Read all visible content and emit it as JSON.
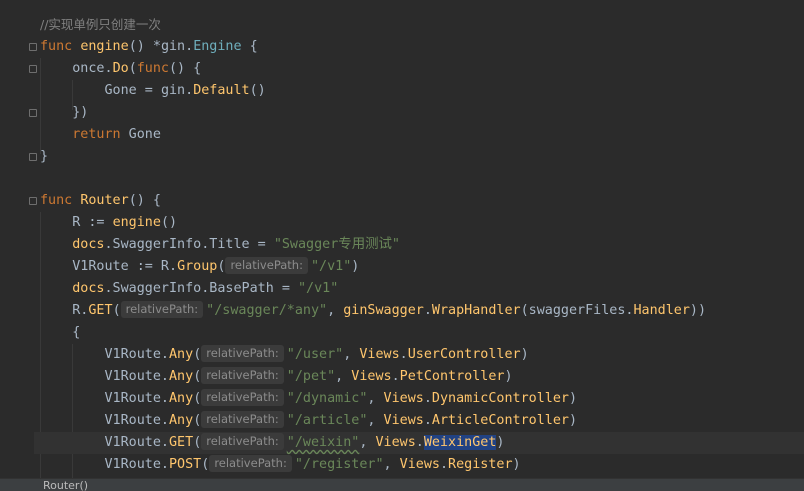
{
  "editor": {
    "comment": "//实现单例只创建一次",
    "engine_func": {
      "kw_func": "func",
      "name": "engine",
      "sig": "() *",
      "pkg": "gin",
      "dot": ".",
      "type": "Engine",
      "open": " {"
    },
    "once_line": {
      "obj": "once.",
      "method": "Do",
      "paren": "(",
      "kw": "func",
      "rest": "() {"
    },
    "gone_line": {
      "lhs": "Gone = ",
      "pkg": "gin",
      "dot": ".",
      "method": "Default",
      "rest": "()"
    },
    "close_paren": "})",
    "return_line": {
      "kw": "return",
      "rest": " Gone"
    },
    "close_brace": "}",
    "router_func": {
      "kw_func": "func",
      "name": "Router",
      "rest": "() {"
    },
    "r_line": {
      "lhs": "R := ",
      "call": "engine",
      "rest": "()"
    },
    "title_line": {
      "pkg": "docs",
      "rest": ".SwaggerInfo.Title = ",
      "str": "\"Swagger专用测试\""
    },
    "v1route_line": {
      "lhs": "V1Route := R.",
      "method": "Group",
      "paren": "(",
      "hint": "relativePath:",
      "str": "\"/v1\"",
      "rest": ")"
    },
    "basepath_line": {
      "pkg": "docs",
      "rest": ".SwaggerInfo.BasePath = ",
      "str": "\"/v1\""
    },
    "rget_line": {
      "obj": "R.",
      "method": "GET",
      "paren": "(",
      "hint": "relativePath:",
      "str": "\"/swagger/*any\"",
      "comma": ", ",
      "pkg": "ginSwagger",
      "dot": ".",
      "call": "WrapHandler",
      "arg": "(swaggerFiles.",
      "arg_field": "Handler",
      "end": "))"
    },
    "open_block": "{",
    "routes": [
      {
        "method": "Any",
        "hint": "relativePath:",
        "path": "\"/user\"",
        "handler": "UserController"
      },
      {
        "method": "Any",
        "hint": "relativePath:",
        "path": "\"/pet\"",
        "handler": "PetController"
      },
      {
        "method": "Any",
        "hint": "relativePath:",
        "path": "\"/dynamic\"",
        "handler": "DynamicController"
      },
      {
        "method": "Any",
        "hint": "relativePath:",
        "path": "\"/article\"",
        "handler": "ArticleController"
      },
      {
        "method": "GET",
        "hint": "relativePath:",
        "path": "\"/weixin\"",
        "handler": "WeixinGet"
      },
      {
        "method": "POST",
        "hint": "relativePath:",
        "path": "\"/register\"",
        "handler": "Register"
      }
    ],
    "route_obj": "V1Route.",
    "views_pkg": "Views",
    "dot": ".",
    "comma": ", ",
    "close": ")"
  },
  "statusbar": {
    "breadcrumb": "Router()"
  }
}
